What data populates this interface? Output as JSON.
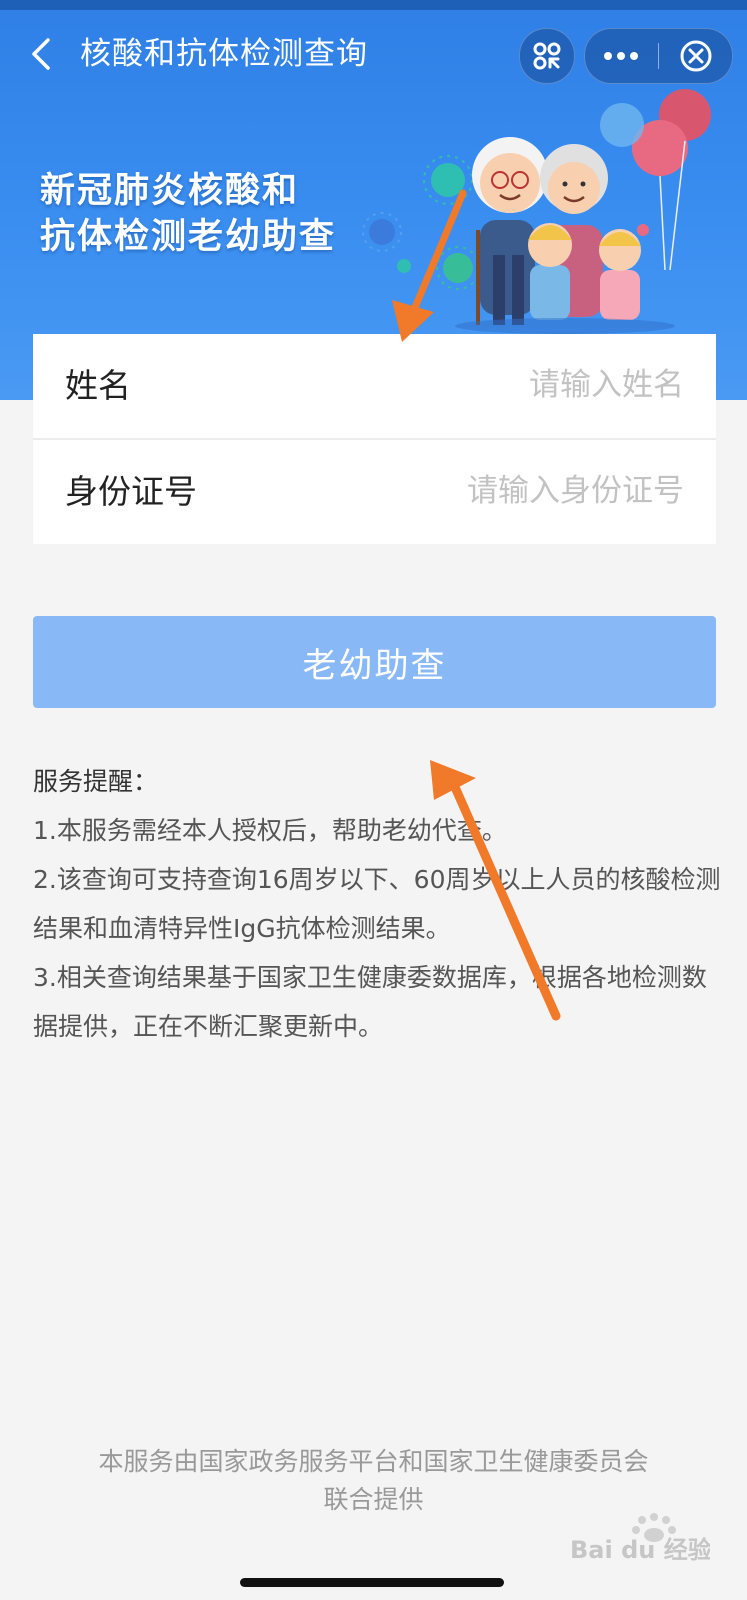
{
  "nav": {
    "title": "核酸和抗体检测查询",
    "back_icon": "chevron-left-icon",
    "scan_icon": "scan-icon",
    "more_icon": "more-dots-icon",
    "close_icon": "close-circle-icon"
  },
  "banner": {
    "title_line1": "新冠肺炎核酸和",
    "title_line2": "抗体检测老幼助查",
    "illustration": "family-balloons-illustration"
  },
  "form": {
    "name": {
      "label": "姓名",
      "placeholder": "请输入姓名",
      "value": ""
    },
    "id_number": {
      "label": "身份证号",
      "placeholder": "请输入身份证号",
      "value": ""
    }
  },
  "submit_label": "老幼助查",
  "notice": {
    "title": "服务提醒：",
    "items": [
      "1.本服务需经本人授权后，帮助老幼代查。",
      "2.该查询可支持查询16周岁以下、60周岁以上人员的核酸检测结果和血清特异性IgG抗体检测结果。",
      "3.相关查询结果基于国家卫生健康委数据库，根据各地检测数据提供，正在不断汇聚更新中。"
    ]
  },
  "footer": {
    "line1": "本服务由国家政务服务平台和国家卫生健康委员会",
    "line2": "联合提供"
  },
  "watermark": "Bai du 经验",
  "colors": {
    "banner": "#3a8ef0",
    "button": "#88b8f5",
    "arrow": "#f07a2a"
  }
}
